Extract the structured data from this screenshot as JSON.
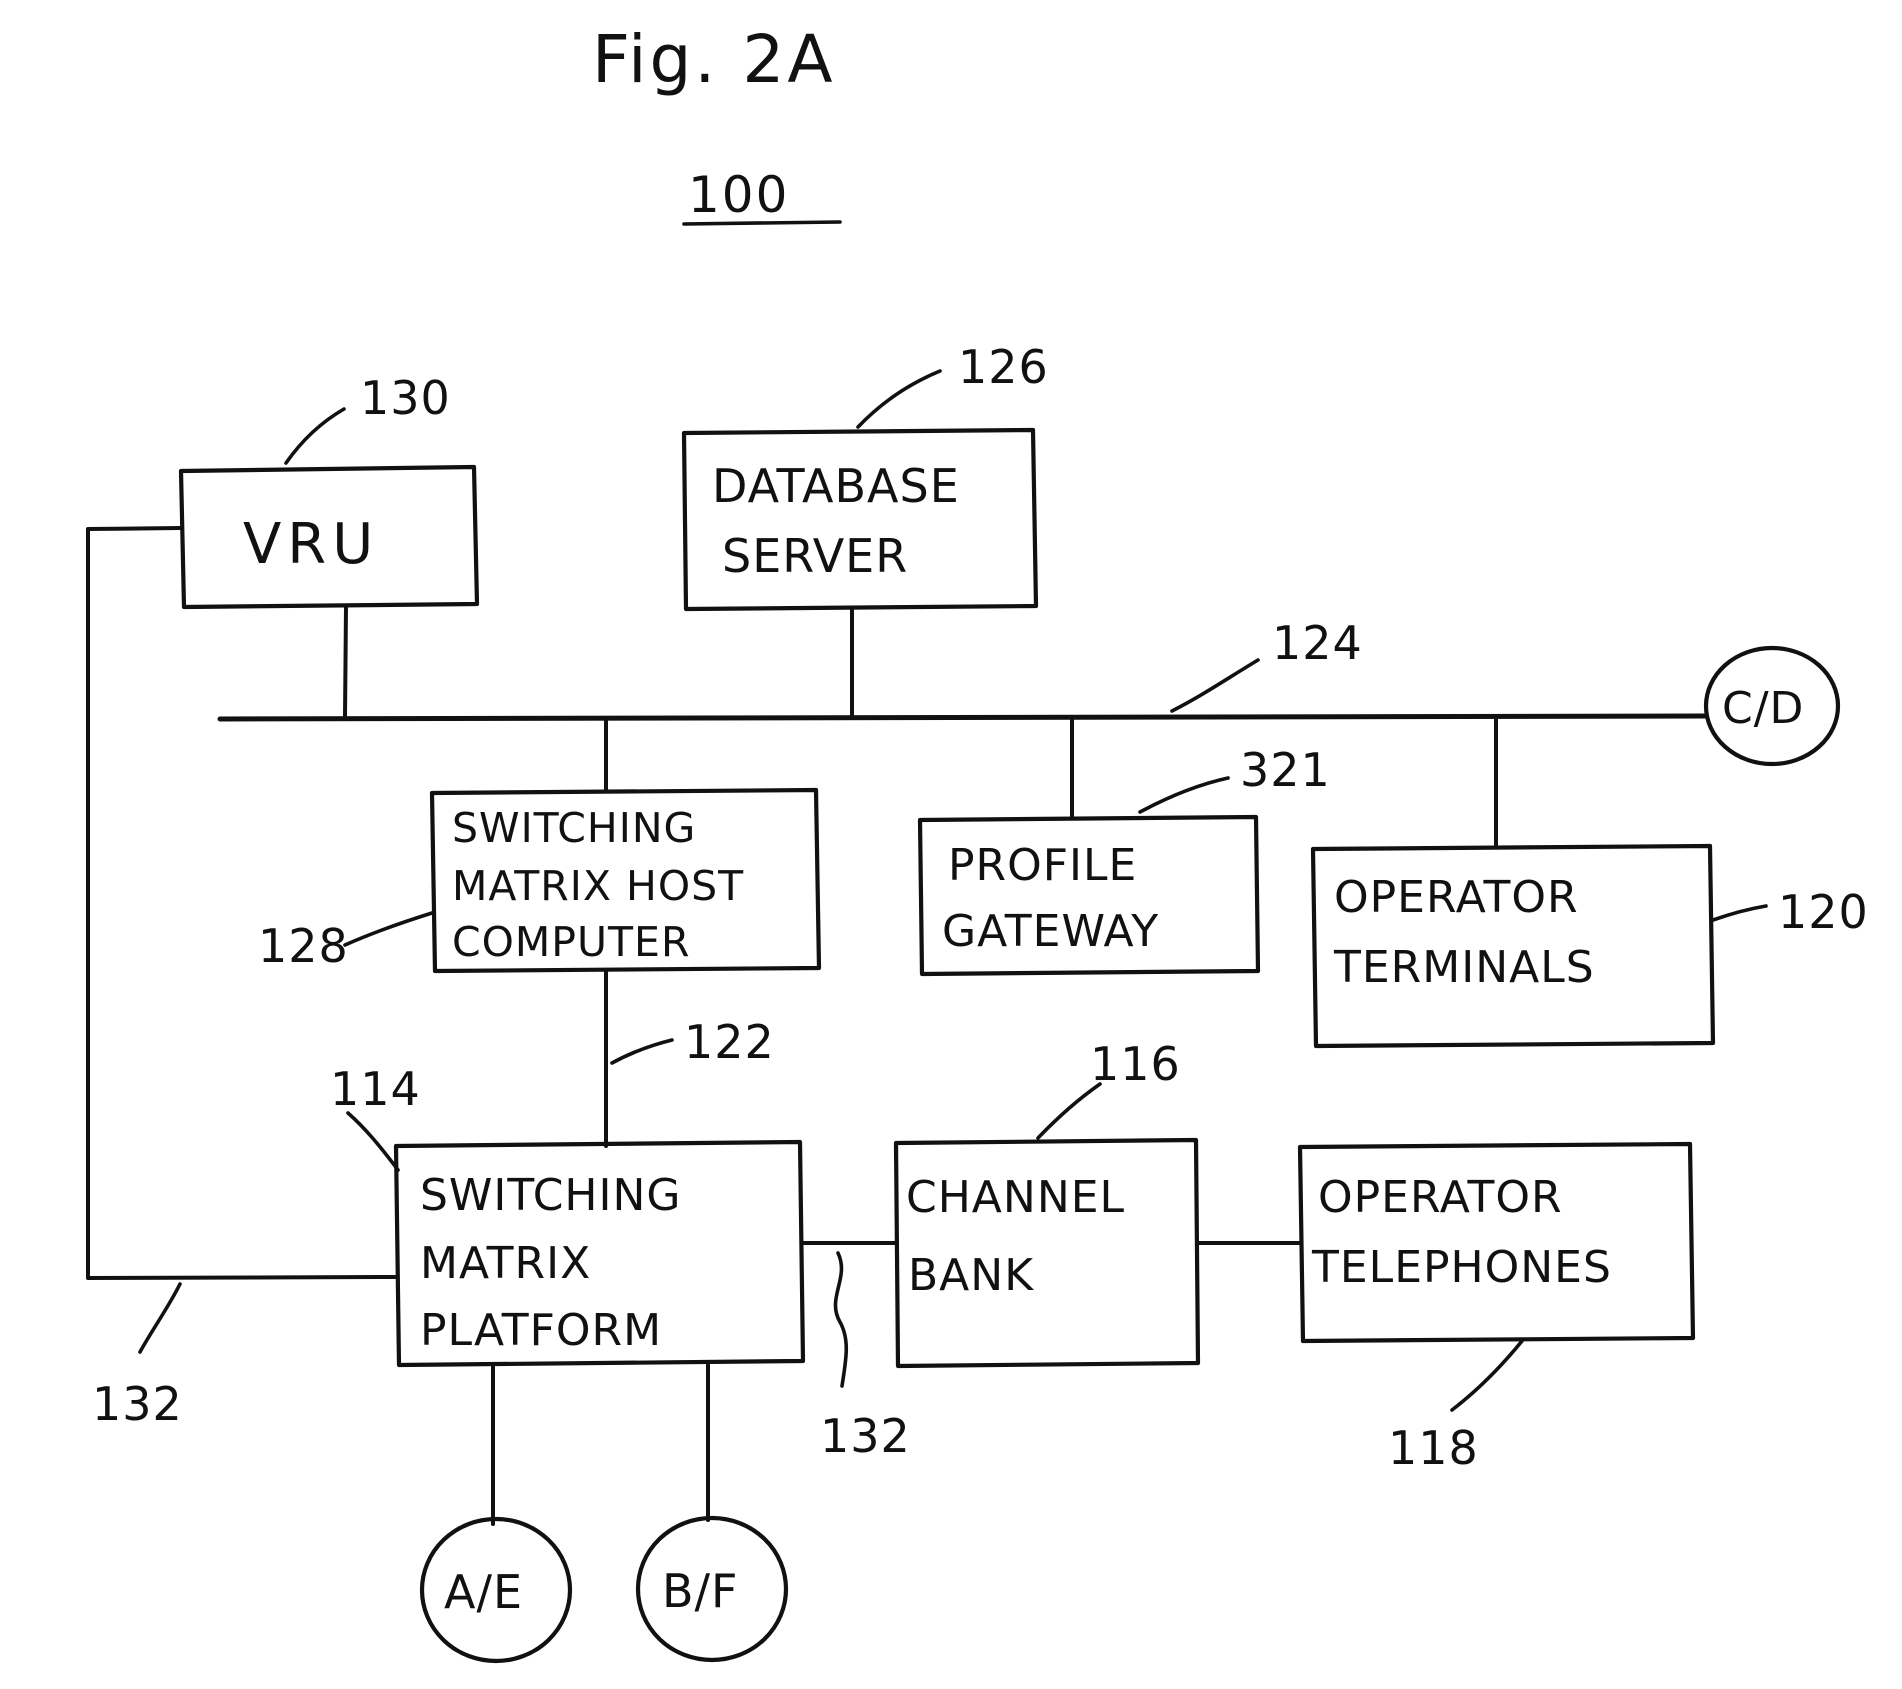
{
  "figure": {
    "title": "Fig. 2A",
    "system_label": "100"
  },
  "nodes": [
    {
      "id": "vru",
      "label_lines": [
        "VRU"
      ],
      "ref": "130"
    },
    {
      "id": "database-server",
      "label_lines": [
        "DATABASE",
        "SERVER"
      ],
      "ref": "126"
    },
    {
      "id": "switching-matrix-host-computer",
      "label_lines": [
        "SWITCHING",
        "MATRIX HOST",
        "COMPUTER"
      ],
      "ref": "128"
    },
    {
      "id": "profile-gateway",
      "label_lines": [
        "PROFILE",
        "GATEWAY"
      ],
      "ref": "321"
    },
    {
      "id": "operator-terminals",
      "label_lines": [
        "OPERATOR",
        "TERMINALS"
      ],
      "ref": "120"
    },
    {
      "id": "switching-matrix-platform",
      "label_lines": [
        "SWITCHING",
        "MATRIX",
        "PLATFORM"
      ],
      "ref": "114"
    },
    {
      "id": "channel-bank",
      "label_lines": [
        "CHANNEL",
        "BANK"
      ],
      "ref": "116"
    },
    {
      "id": "operator-telephones",
      "label_lines": [
        "OPERATOR",
        "TELEPHONES"
      ],
      "ref": "118"
    }
  ],
  "terminals": [
    {
      "id": "cd-terminal",
      "label": "C/D"
    },
    {
      "id": "ae-terminal",
      "label": "A/E"
    },
    {
      "id": "bf-terminal",
      "label": "B/F"
    }
  ],
  "reference_labels": [
    {
      "id": "ref-130",
      "text": "130"
    },
    {
      "id": "ref-126",
      "text": "126"
    },
    {
      "id": "ref-124",
      "text": "124"
    },
    {
      "id": "ref-321",
      "text": "321"
    },
    {
      "id": "ref-128",
      "text": "128"
    },
    {
      "id": "ref-120",
      "text": "120"
    },
    {
      "id": "ref-122",
      "text": "122"
    },
    {
      "id": "ref-114",
      "text": "114"
    },
    {
      "id": "ref-116",
      "text": "116"
    },
    {
      "id": "ref-118",
      "text": "118"
    },
    {
      "id": "ref-132-left",
      "text": "132"
    },
    {
      "id": "ref-132-center",
      "text": "132"
    }
  ],
  "colors": {
    "ink": "#111111",
    "paper": "#ffffff"
  }
}
